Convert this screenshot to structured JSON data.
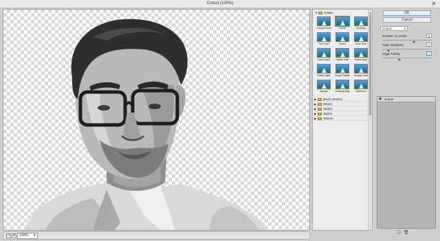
{
  "window": {
    "title": "Cutout (100%)",
    "close_glyph": "✕"
  },
  "canvas": {
    "zoom_out": "−",
    "zoom_in": "+",
    "zoom": "100%",
    "zoom_caret": "▾"
  },
  "gallery": {
    "artistic_folder": "Artistic",
    "filters": [
      "Colored Pencil",
      "Cutout",
      "Dry Brush",
      "Film Grain",
      "Fresco",
      "Neon Glow",
      "Paint Daubs",
      "Palette Knife",
      "Plastic Wrap",
      "Poster Edges",
      "Rough Pastels",
      "Smudge Stick",
      "Sponge",
      "Underpainting",
      "Watercolor"
    ],
    "selected_filter": "Cutout",
    "categories": [
      "Brush Strokes",
      "Distort",
      "Sketch",
      "Stylize",
      "Texture"
    ]
  },
  "panel": {
    "ok_label": "OK",
    "cancel_label": "Cancel",
    "filter_select": "Cutout",
    "params": [
      {
        "label": "Number of Levels",
        "value": "8",
        "fraction": 0.625
      },
      {
        "label": "Edge Simplicity",
        "value": "1",
        "fraction": 0.1
      },
      {
        "label": "Edge Fidelity",
        "value": "1",
        "fraction": 0.33
      }
    ],
    "layers": [
      {
        "name": "Cutout"
      }
    ]
  },
  "icons": {
    "eye": "eye-icon",
    "new_layer": "new-effect-layer-icon",
    "delete_layer": "delete-effect-layer-icon"
  }
}
